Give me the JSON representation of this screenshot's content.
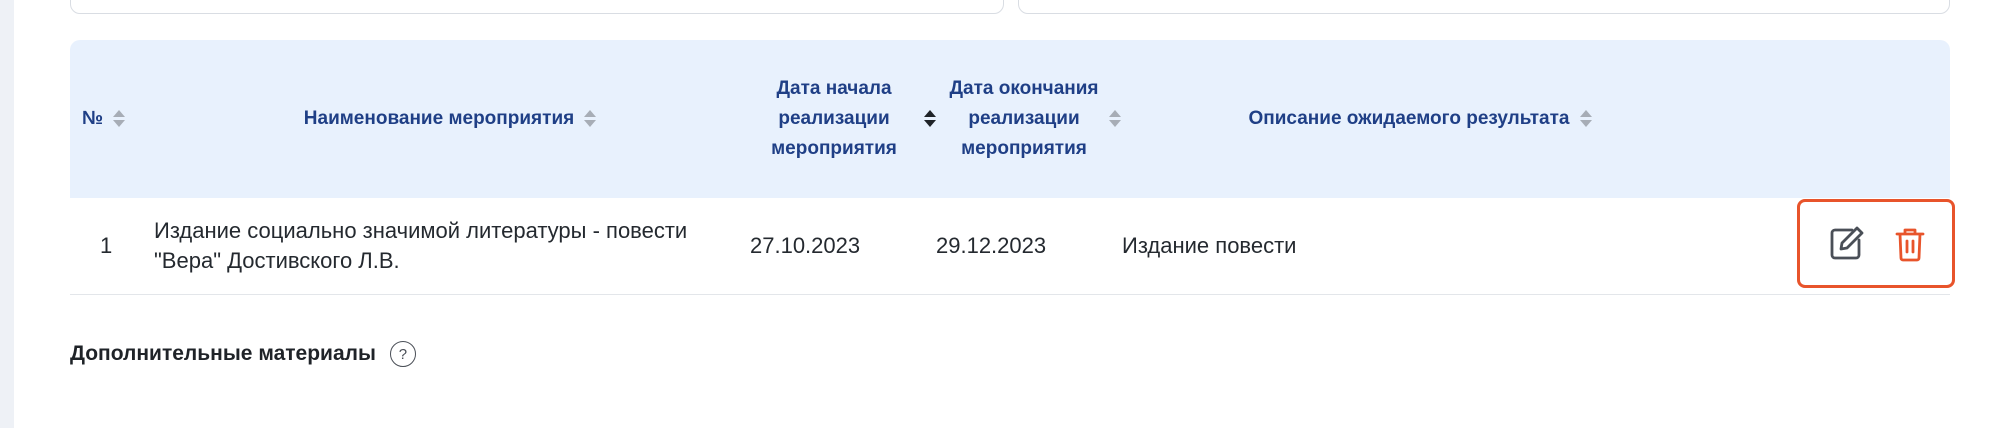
{
  "table": {
    "headers": {
      "number": "№",
      "event_name": "Наименование мероприятия",
      "start_date": "Дата начала реализации мероприятия",
      "end_date": "Дата окончания реализации мероприятия",
      "result_description": "Описание ожидаемого результата"
    },
    "rows": [
      {
        "number": "1",
        "event_name": "Издание социально значимой литературы - повести \"Вера\" Достивского Л.В.",
        "start_date": "27.10.2023",
        "end_date": "29.12.2023",
        "result_description": "Издание повести"
      }
    ]
  },
  "row_actions": {
    "edit_icon": "edit-icon",
    "delete_icon": "trash-icon",
    "highlight_color": "#e8542b"
  },
  "sections": {
    "additional_materials_title": "Дополнительные материалы",
    "help_glyph": "?"
  },
  "colors": {
    "header_bg": "#e8f1fd",
    "header_text": "#1f3f86"
  }
}
